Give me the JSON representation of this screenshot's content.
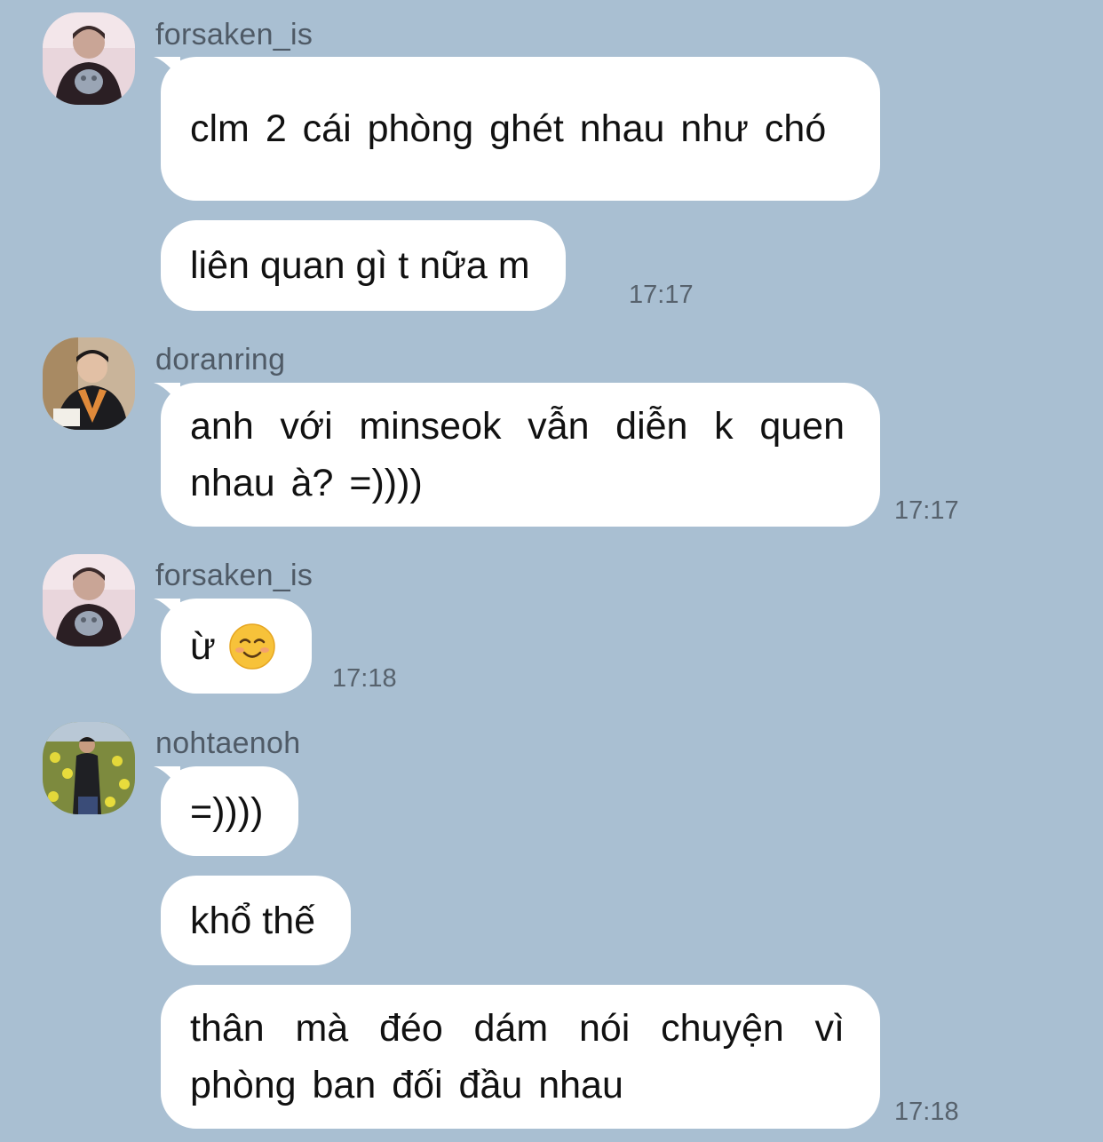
{
  "messages": [
    {
      "sender": "forsaken_is",
      "texts": [
        "clm 2 cái phòng ghét nhau như chó",
        "liên quan gì t nữa m"
      ],
      "time": "17:17"
    },
    {
      "sender": "doranring",
      "texts": [
        "anh với minseok vẫn diễn k quen nhau à? =))))"
      ],
      "time": "17:17"
    },
    {
      "sender": "forsaken_is",
      "texts": [
        "ừ"
      ],
      "emoji": "smiling-face-icon",
      "time": "17:18"
    },
    {
      "sender": "nohtaenoh",
      "texts": [
        "=))))",
        "khổ thế",
        "thân mà đéo dám nói chuyện vì phòng ban đối đầu nhau"
      ],
      "time": "17:18"
    }
  ],
  "colors": {
    "background": "#a9bfd2",
    "bubble": "#ffffff",
    "sender_text": "#4f5a66",
    "timestamp": "#57626d"
  }
}
